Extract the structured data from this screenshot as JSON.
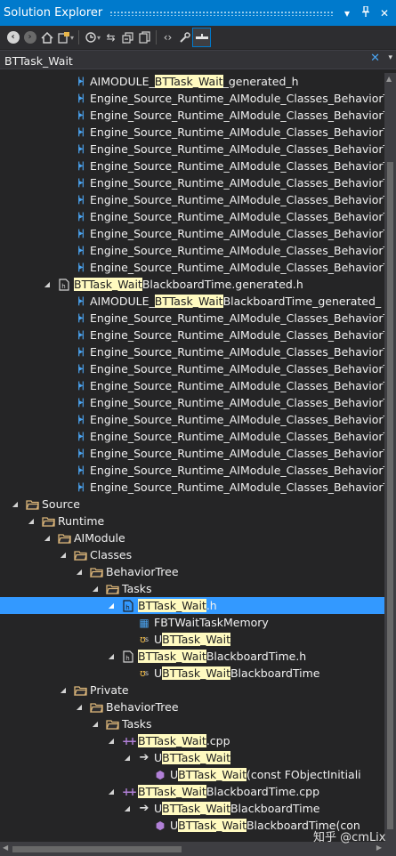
{
  "window": {
    "title": "Solution Explorer",
    "title_icons": [
      "dropdown-icon",
      "pin-icon",
      "close-icon"
    ]
  },
  "toolbar": {
    "buttons": [
      "back-icon",
      "forward-icon",
      "home-icon",
      "switch-views-icon",
      "pending-changes-icon",
      "sync-icon",
      "collapse-all-icon",
      "show-all-files-icon",
      "view-code-icon",
      "properties-icon",
      "preview-icon"
    ]
  },
  "search": {
    "value": "BTTask_Wait"
  },
  "tree": [
    {
      "d": 5,
      "icon": "macro",
      "parts": [
        [
          "AIMODULE_",
          0
        ],
        [
          "BTTask_Wait",
          1
        ],
        [
          "_generated_h",
          0
        ]
      ]
    },
    {
      "d": 5,
      "icon": "macro",
      "parts": [
        [
          "Engine_Source_Runtime_AIModule_Classes_BehaviorT",
          0
        ]
      ]
    },
    {
      "d": 5,
      "icon": "macro",
      "parts": [
        [
          "Engine_Source_Runtime_AIModule_Classes_BehaviorT",
          0
        ]
      ]
    },
    {
      "d": 5,
      "icon": "macro",
      "parts": [
        [
          "Engine_Source_Runtime_AIModule_Classes_BehaviorT",
          0
        ]
      ]
    },
    {
      "d": 5,
      "icon": "macro",
      "parts": [
        [
          "Engine_Source_Runtime_AIModule_Classes_BehaviorT",
          0
        ]
      ]
    },
    {
      "d": 5,
      "icon": "macro",
      "parts": [
        [
          "Engine_Source_Runtime_AIModule_Classes_BehaviorT",
          0
        ]
      ]
    },
    {
      "d": 5,
      "icon": "macro",
      "parts": [
        [
          "Engine_Source_Runtime_AIModule_Classes_BehaviorT",
          0
        ]
      ]
    },
    {
      "d": 5,
      "icon": "macro",
      "parts": [
        [
          "Engine_Source_Runtime_AIModule_Classes_BehaviorT",
          0
        ]
      ]
    },
    {
      "d": 5,
      "icon": "macro",
      "parts": [
        [
          "Engine_Source_Runtime_AIModule_Classes_BehaviorT",
          0
        ]
      ]
    },
    {
      "d": 5,
      "icon": "macro",
      "parts": [
        [
          "Engine_Source_Runtime_AIModule_Classes_BehaviorT",
          0
        ]
      ]
    },
    {
      "d": 5,
      "icon": "macro",
      "parts": [
        [
          "Engine_Source_Runtime_AIModule_Classes_BehaviorT",
          0
        ]
      ]
    },
    {
      "d": 5,
      "icon": "macro",
      "parts": [
        [
          "Engine_Source_Runtime_AIModule_Classes_BehaviorT",
          0
        ]
      ]
    },
    {
      "d": 4,
      "arrow": "open",
      "icon": "hfile",
      "parts": [
        [
          "BTTask_Wait",
          1
        ],
        [
          "BlackboardTime.generated.h",
          0
        ]
      ]
    },
    {
      "d": 5,
      "icon": "macro",
      "parts": [
        [
          "AIMODULE_",
          0
        ],
        [
          "BTTask_Wait",
          1
        ],
        [
          "BlackboardTime_generated_",
          0
        ]
      ]
    },
    {
      "d": 5,
      "icon": "macro",
      "parts": [
        [
          "Engine_Source_Runtime_AIModule_Classes_BehaviorT",
          0
        ]
      ]
    },
    {
      "d": 5,
      "icon": "macro",
      "parts": [
        [
          "Engine_Source_Runtime_AIModule_Classes_BehaviorT",
          0
        ]
      ]
    },
    {
      "d": 5,
      "icon": "macro",
      "parts": [
        [
          "Engine_Source_Runtime_AIModule_Classes_BehaviorT",
          0
        ]
      ]
    },
    {
      "d": 5,
      "icon": "macro",
      "parts": [
        [
          "Engine_Source_Runtime_AIModule_Classes_BehaviorT",
          0
        ]
      ]
    },
    {
      "d": 5,
      "icon": "macro",
      "parts": [
        [
          "Engine_Source_Runtime_AIModule_Classes_BehaviorT",
          0
        ]
      ]
    },
    {
      "d": 5,
      "icon": "macro",
      "parts": [
        [
          "Engine_Source_Runtime_AIModule_Classes_BehaviorT",
          0
        ]
      ]
    },
    {
      "d": 5,
      "icon": "macro",
      "parts": [
        [
          "Engine_Source_Runtime_AIModule_Classes_BehaviorT",
          0
        ]
      ]
    },
    {
      "d": 5,
      "icon": "macro",
      "parts": [
        [
          "Engine_Source_Runtime_AIModule_Classes_BehaviorT",
          0
        ]
      ]
    },
    {
      "d": 5,
      "icon": "macro",
      "parts": [
        [
          "Engine_Source_Runtime_AIModule_Classes_BehaviorT",
          0
        ]
      ]
    },
    {
      "d": 5,
      "icon": "macro",
      "parts": [
        [
          "Engine_Source_Runtime_AIModule_Classes_BehaviorT",
          0
        ]
      ]
    },
    {
      "d": 5,
      "icon": "macro",
      "parts": [
        [
          "Engine_Source_Runtime_AIModule_Classes_BehaviorT",
          0
        ]
      ]
    },
    {
      "d": 2,
      "arrow": "open",
      "icon": "folder",
      "parts": [
        [
          "Source",
          0
        ]
      ]
    },
    {
      "d": 3,
      "arrow": "open",
      "icon": "folder",
      "parts": [
        [
          "Runtime",
          0
        ]
      ]
    },
    {
      "d": 4,
      "arrow": "open",
      "icon": "folder",
      "parts": [
        [
          "AIModule",
          0
        ]
      ]
    },
    {
      "d": 5,
      "arrow": "open",
      "icon": "folder",
      "parts": [
        [
          "Classes",
          0
        ]
      ]
    },
    {
      "d": 6,
      "arrow": "open",
      "icon": "folder",
      "parts": [
        [
          "BehaviorTree",
          0
        ]
      ]
    },
    {
      "d": 7,
      "arrow": "open",
      "icon": "folder",
      "parts": [
        [
          "Tasks",
          0
        ]
      ]
    },
    {
      "d": 8,
      "arrow": "open",
      "icon": "hfile",
      "selected": true,
      "parts": [
        [
          "BTTask_Wait",
          1
        ],
        [
          ".h",
          0
        ]
      ]
    },
    {
      "d": 9,
      "icon": "struct",
      "parts": [
        [
          "FBTWaitTaskMemory",
          0
        ]
      ]
    },
    {
      "d": 9,
      "icon": "class",
      "parts": [
        [
          "U",
          0
        ],
        [
          "BTTask_Wait",
          1
        ]
      ]
    },
    {
      "d": 8,
      "arrow": "open",
      "icon": "hfile",
      "parts": [
        [
          "BTTask_Wait",
          1
        ],
        [
          "BlackboardTime.h",
          0
        ]
      ]
    },
    {
      "d": 9,
      "icon": "class",
      "parts": [
        [
          "U",
          0
        ],
        [
          "BTTask_Wait",
          1
        ],
        [
          "BlackboardTime",
          0
        ]
      ]
    },
    {
      "d": 5,
      "arrow": "open",
      "icon": "folder",
      "parts": [
        [
          "Private",
          0
        ]
      ]
    },
    {
      "d": 6,
      "arrow": "open",
      "icon": "folder",
      "parts": [
        [
          "BehaviorTree",
          0
        ]
      ]
    },
    {
      "d": 7,
      "arrow": "open",
      "icon": "folder",
      "parts": [
        [
          "Tasks",
          0
        ]
      ]
    },
    {
      "d": 8,
      "arrow": "open",
      "icon": "cpp",
      "parts": [
        [
          "BTTask_Wait",
          1
        ],
        [
          ".cpp",
          0
        ]
      ]
    },
    {
      "d": 9,
      "arrow": "open",
      "icon": "ref",
      "parts": [
        [
          "U",
          0
        ],
        [
          "BTTask_Wait",
          1
        ]
      ]
    },
    {
      "d": 10,
      "icon": "method",
      "parts": [
        [
          "U",
          0
        ],
        [
          "BTTask_Wait",
          1
        ],
        [
          "(const FObjectInitiali",
          0
        ]
      ]
    },
    {
      "d": 8,
      "arrow": "open",
      "icon": "cpp",
      "parts": [
        [
          "BTTask_Wait",
          1
        ],
        [
          "BlackboardTime.cpp",
          0
        ]
      ]
    },
    {
      "d": 9,
      "arrow": "open",
      "icon": "ref",
      "parts": [
        [
          "U",
          0
        ],
        [
          "BTTask_Wait",
          1
        ],
        [
          "BlackboardTime",
          0
        ]
      ]
    },
    {
      "d": 10,
      "icon": "method",
      "parts": [
        [
          "U",
          0
        ],
        [
          "BTTask_Wait",
          1
        ],
        [
          "BlackboardTime(con",
          0
        ]
      ]
    }
  ],
  "watermark": "知乎 @cmLix"
}
